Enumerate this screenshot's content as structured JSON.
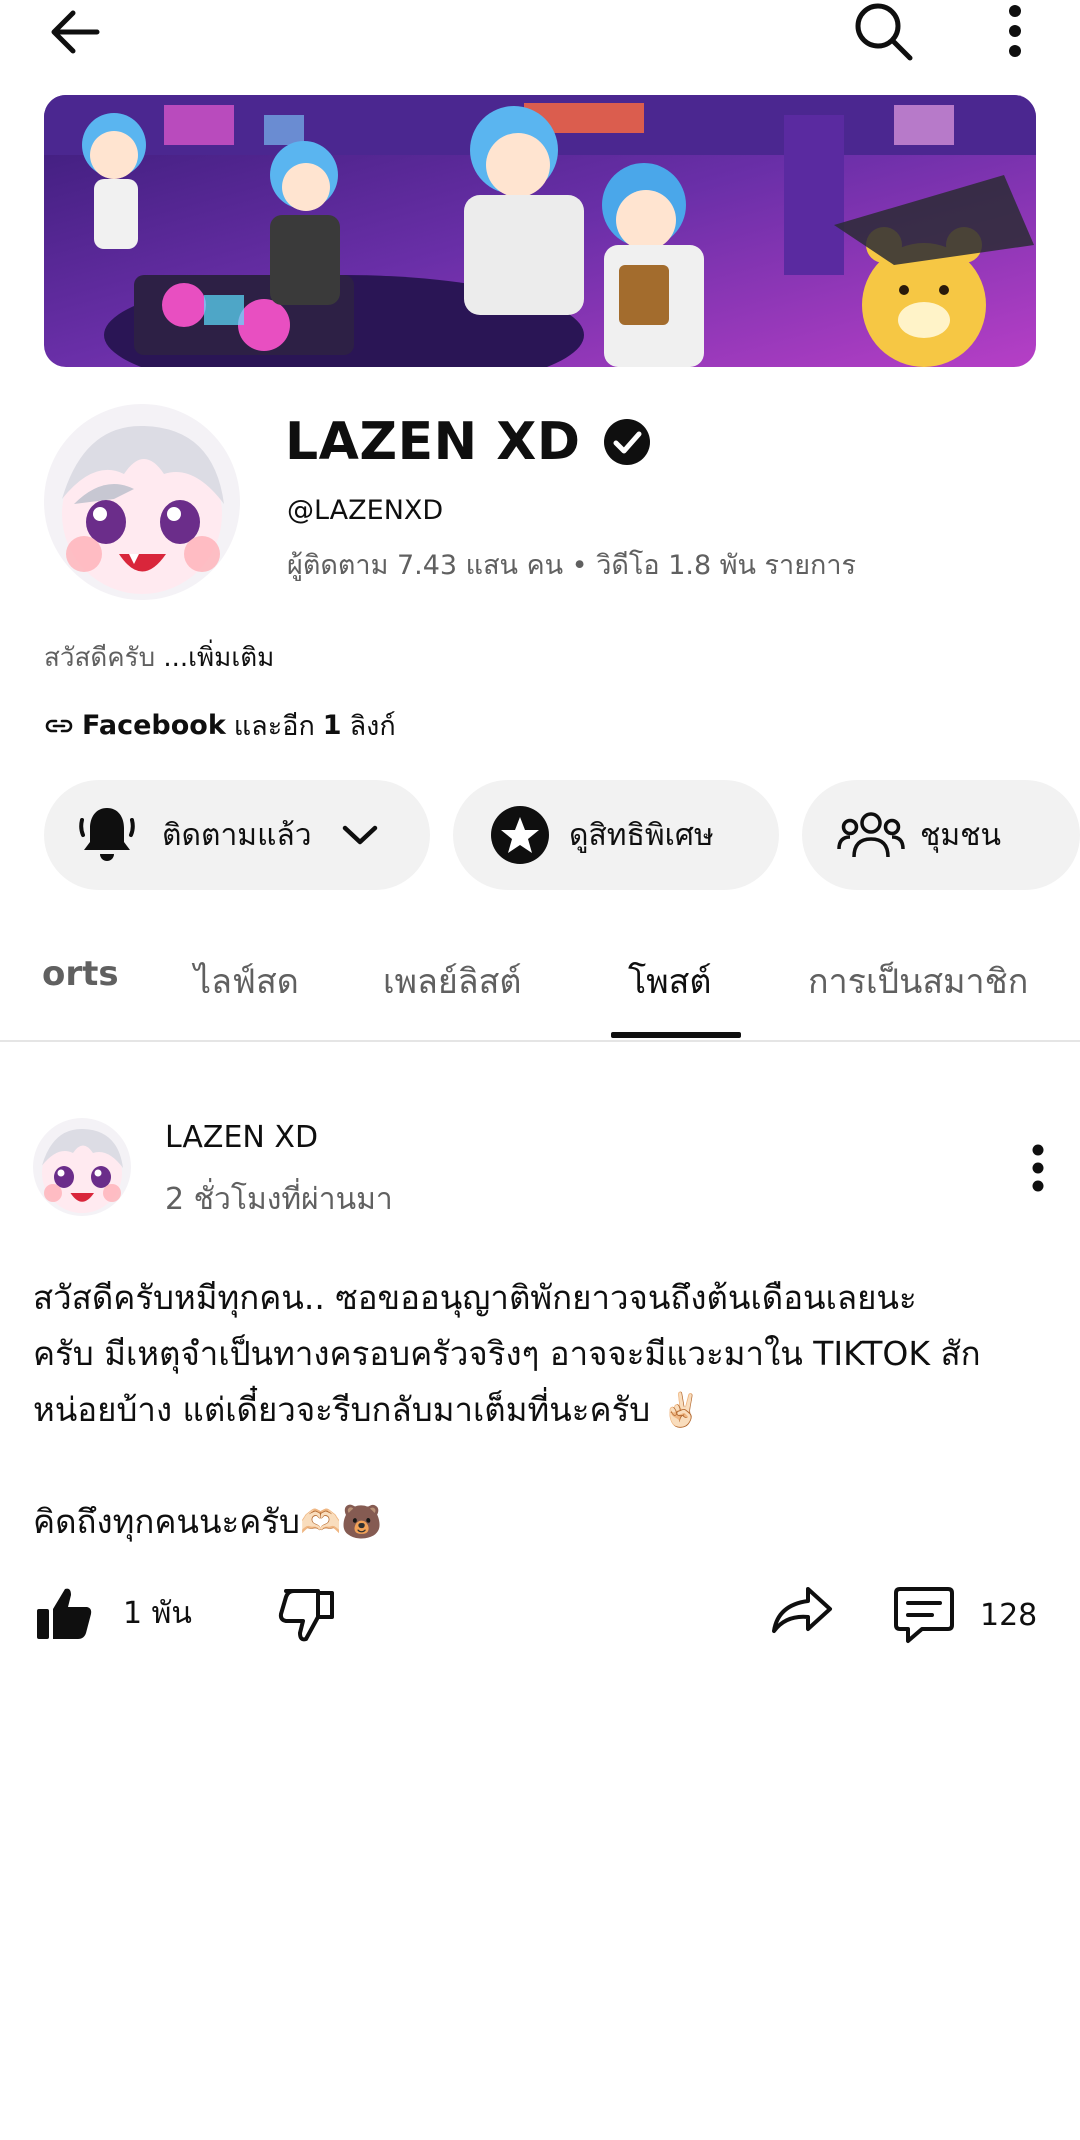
{
  "topbar": {
    "back_icon": "arrow-left-icon",
    "search_icon": "search-icon",
    "more_icon": "more-vert-icon"
  },
  "channel": {
    "name": "LAZEN XD",
    "verified_icon": "verified-check-icon",
    "handle": "@LAZENXD",
    "stats": "ผู้ติดตาม 7.43 แสน คน • วิดีโอ 1.8 พัน รายการ",
    "about_text": "สวัสดีครับ",
    "about_more": "...เพิ่มเติม",
    "link_icon": "link-icon",
    "link_primary": "Facebook",
    "link_suffix": "และอีก",
    "link_count": "1",
    "link_unit": "ลิงก์"
  },
  "actions": {
    "subscribed_label": "ติดตามแล้ว",
    "perks_label": "ดูสิทธิพิเศษ",
    "community_label": "ชุมชน"
  },
  "tabs": [
    {
      "label": "orts",
      "active": false
    },
    {
      "label": "ไลฟ์สด",
      "active": false
    },
    {
      "label": "เพลย์ลิสต์",
      "active": false
    },
    {
      "label": "โพสต์",
      "active": true
    },
    {
      "label": "การเป็นสมาชิก",
      "active": false
    }
  ],
  "post": {
    "author": "LAZEN XD",
    "time": "2 ชั่วโมงที่ผ่านมา",
    "body": "สวัสดีครับหมีทุกคน.. ซอขออนุญาติพักยาวจนถึงต้นเดือนเลยนะ\nครับ มีเหตุจำเป็นทางครอบครัวจริงๆ อาจจะมีแวะมาใน TIKTOK สัก\nหน่อยบ้าง แต่เดี๋ยวจะรีบกลับมาเต็มที่นะครับ ✌🏻\n\nคิดถึงทุกคนนะครับ🫶🏻🐻",
    "likes": "1 พัน",
    "comments": "128"
  },
  "colors": {
    "text_primary": "#0f0f0f",
    "text_secondary": "#606060",
    "pill_bg": "#f2f2f2",
    "divider": "#e5e5e5",
    "banner_purple": "#6a2fa8",
    "banner_pink": "#e85bd0"
  }
}
